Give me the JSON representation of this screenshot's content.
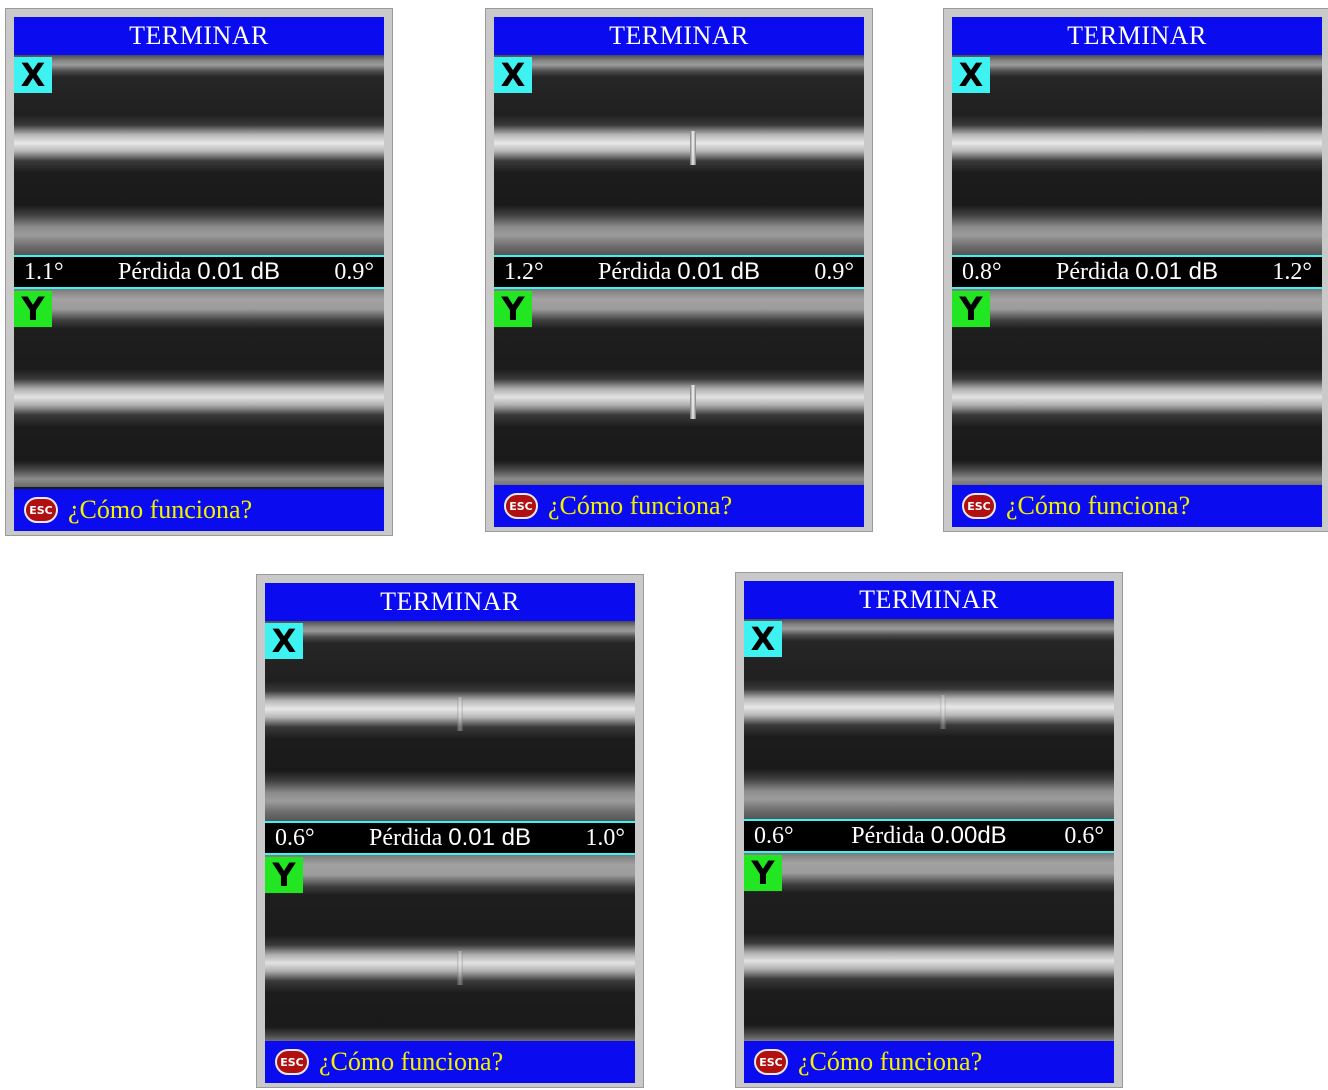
{
  "screens": [
    {
      "title": "TERMINAR",
      "x_label": "X",
      "y_label": "Y",
      "angle_left": "1.1°",
      "loss_label": "Pérdida",
      "loss_value": "0.01 dB",
      "angle_right": "0.9°",
      "esc_label": "ESC",
      "help_text": "¿Cómo funciona?"
    },
    {
      "title": "TERMINAR",
      "x_label": "X",
      "y_label": "Y",
      "angle_left": "1.2°",
      "loss_label": "Pérdida",
      "loss_value": "0.01 dB",
      "angle_right": "0.9°",
      "esc_label": "ESC",
      "help_text": "¿Cómo funciona?"
    },
    {
      "title": "TERMINAR",
      "x_label": "X",
      "y_label": "Y",
      "angle_left": "0.8°",
      "loss_label": "Pérdida",
      "loss_value": "0.01 dB",
      "angle_right": "1.2°",
      "esc_label": "ESC",
      "help_text": "¿Cómo funciona?"
    },
    {
      "title": "TERMINAR",
      "x_label": "X",
      "y_label": "Y",
      "angle_left": "0.6°",
      "loss_label": "Pérdida",
      "loss_value": "0.01 dB",
      "angle_right": "1.0°",
      "esc_label": "ESC",
      "help_text": "¿Cómo funciona?"
    },
    {
      "title": "TERMINAR",
      "x_label": "X",
      "y_label": "Y",
      "angle_left": "0.6°",
      "loss_label": "Pérdida",
      "loss_value": "0.00dB",
      "angle_right": "0.6°",
      "esc_label": "ESC",
      "help_text": "¿Cómo funciona?"
    }
  ],
  "colors": {
    "title_bar": "#0b0bf0",
    "x_label_bg": "#3ff2f2",
    "y_label_bg": "#22e622",
    "help_text": "#f2f200",
    "esc_icon": "#b11010"
  },
  "icons": {
    "esc": "esc-key-icon"
  }
}
